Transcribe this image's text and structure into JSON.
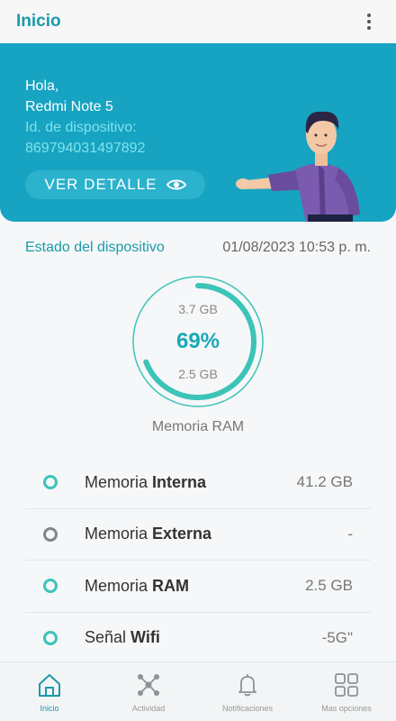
{
  "app_bar": {
    "title": "Inicio",
    "menu_icon": "more-vertical-icon"
  },
  "hero": {
    "greeting": "Hola,",
    "device_name": "Redmi Note 5",
    "id_label": "Id. de dispositivo:",
    "device_id": "869794031497892",
    "detail_button": "VER DETALLE",
    "detail_icon": "eye-icon",
    "colors": {
      "background": "#17a3c2",
      "accent_text": "#7fe3ea"
    }
  },
  "status": {
    "label": "Estado del dispositivo",
    "datetime": "01/08/2023 10:53 p. m."
  },
  "gauge": {
    "total": "3.7 GB",
    "percent_label": "69%",
    "used": "2.5 GB",
    "caption": "Memoria RAM",
    "fill_fraction": 0.69,
    "color": "#3cc4b8"
  },
  "items": [
    {
      "prefix": "Memoria ",
      "bold": "Interna",
      "value": "41.2 GB",
      "status": "active"
    },
    {
      "prefix": "Memoria ",
      "bold": "Externa",
      "value": "-",
      "status": "inactive"
    },
    {
      "prefix": "Memoria ",
      "bold": "RAM",
      "value": "2.5 GB",
      "status": "active"
    },
    {
      "prefix": "Señal ",
      "bold": "Wifi",
      "value": "-5G\"",
      "status": "active"
    }
  ],
  "nav": [
    {
      "label": "Inicio",
      "icon": "home-icon",
      "active": true
    },
    {
      "label": "Actividad",
      "icon": "network-icon",
      "active": false
    },
    {
      "label": "Notificaciones",
      "icon": "bell-icon",
      "active": false
    },
    {
      "label": "Mas opciones",
      "icon": "grid-icon",
      "active": false
    }
  ]
}
